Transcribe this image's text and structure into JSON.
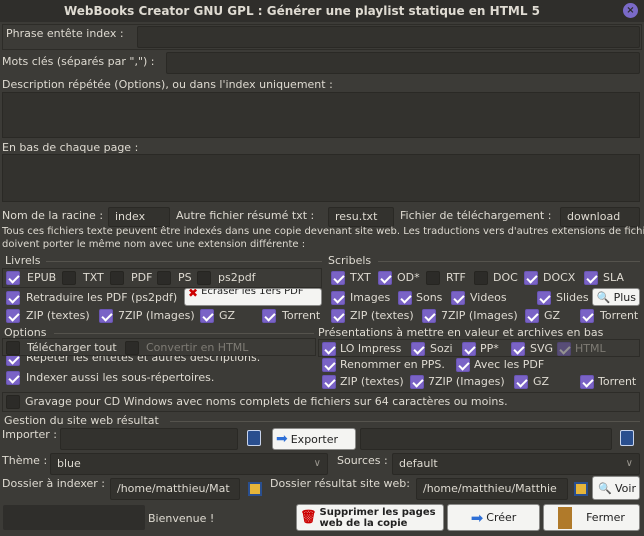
{
  "window": {
    "title": "WebBooks Creator  GNU GPL  : Générer une playlist statique en HTML 5",
    "close_icon": "close-icon"
  },
  "fields": {
    "phrase_label": "Phrase  entête index :",
    "phrase_value": "",
    "keywords_label": "Mots clés (séparés par \",\") :",
    "keywords_value": "",
    "description_label": "Description répétée (Options), ou  dans l'index uniquement :",
    "footer_label": "En bas de chaque page :",
    "root_label": "Nom de la racine :",
    "root_value": "index",
    "summary_label": "Autre fichier résumé txt :",
    "summary_value": "resu.txt",
    "download_label": "Fichier de téléchargement :",
    "download_value": "download"
  },
  "info": {
    "line1": "Tous ces fichiers texte peuvent être indexés dans une copie devenant site web. Les traductions vers d'autres extensions de fichier",
    "line2": "doivent porter le même nom avec une extension différente :"
  },
  "livrels": {
    "title": "Livrels",
    "formats": [
      {
        "label": "EPUB",
        "checked": true
      },
      {
        "label": "TXT",
        "checked": false
      },
      {
        "label": "PDF",
        "checked": false
      },
      {
        "label": "PS",
        "checked": false
      },
      {
        "label": "ps2pdf",
        "checked": false
      }
    ],
    "retranslate": {
      "label": "Retraduire les PDF (ps2pdf)",
      "checked": true
    },
    "overwrite_button": "Écraser les 1ers PDF",
    "archives": [
      {
        "label": "ZIP (textes)",
        "checked": true
      },
      {
        "label": "7ZIP (Images)",
        "checked": true
      },
      {
        "label": "GZ",
        "checked": true
      },
      {
        "label": "Torrent",
        "checked": true
      }
    ]
  },
  "scribels": {
    "title": "Scribels",
    "formats": [
      {
        "label": "TXT",
        "checked": true
      },
      {
        "label": "OD*",
        "checked": true
      },
      {
        "label": "RTF",
        "checked": false
      },
      {
        "label": "DOC",
        "checked": false
      },
      {
        "label": "DOCX",
        "checked": true
      },
      {
        "label": "SLA",
        "checked": true
      }
    ],
    "media": [
      {
        "label": "Images",
        "checked": true
      },
      {
        "label": "Sons",
        "checked": true
      },
      {
        "label": "Videos",
        "checked": true
      },
      {
        "label": "Slides",
        "checked": true
      }
    ],
    "plus_button": "Plus",
    "archives": [
      {
        "label": "ZIP (textes)",
        "checked": true
      },
      {
        "label": "7ZIP (Images)",
        "checked": true
      },
      {
        "label": "GZ",
        "checked": true
      },
      {
        "label": "Torrent",
        "checked": true
      }
    ]
  },
  "options": {
    "title": "Options",
    "download_all": {
      "label": "Télécharger tout",
      "checked": false
    },
    "convert_html": {
      "label": "Convertir en HTML",
      "checked": false
    },
    "repeat_headers": {
      "label": "Répéter les entêtes et autres descriptions.",
      "checked": true
    },
    "index_subdirs": {
      "label": "Indexer aussi les sous-répertoires.",
      "checked": true
    }
  },
  "presentations": {
    "title": "Présentations à mettre en valeur et archives en bas",
    "formats": [
      {
        "label": "LO Impress",
        "checked": true
      },
      {
        "label": "Sozi",
        "checked": true
      },
      {
        "label": "PP*",
        "checked": true
      },
      {
        "label": "SVG",
        "checked": true
      },
      {
        "label": "HTML",
        "checked": true
      }
    ],
    "rename": {
      "label": "Renommer en PPS.",
      "checked": true
    },
    "with_pdf": {
      "label": "Avec les PDF",
      "checked": true
    },
    "archives": [
      {
        "label": "ZIP (textes)",
        "checked": true
      },
      {
        "label": "7ZIP (Images)",
        "checked": true
      },
      {
        "label": "GZ",
        "checked": true
      },
      {
        "label": "Torrent",
        "checked": true
      }
    ]
  },
  "cd_burn": {
    "label": "Gravage pour CD Windows avec noms complets de fichiers sur 64 caractères ou moins.",
    "checked": false
  },
  "site": {
    "title": "Gestion du site web résultat",
    "import_label": "Importer :",
    "import_value": "",
    "export_button": "Exporter",
    "export_value": "",
    "theme_label": "Thème :",
    "theme_value": "blue",
    "sources_label": "Sources :",
    "sources_value": "default",
    "index_dir_label": "Dossier à indexer :",
    "index_dir_value": "/home/matthieu/Mat",
    "result_dir_label": "Dossier résultat site web:",
    "result_dir_value": "/home/matthieu/Matthie",
    "view_button": "Voir"
  },
  "footer": {
    "status": "Bienvenue !",
    "delete_button": "Supprimer les pages web de la copie",
    "create_button": "Créer",
    "close_button": "Fermer"
  },
  "colors": {
    "background": "#3c3b37",
    "accent": "#7a63c6"
  }
}
